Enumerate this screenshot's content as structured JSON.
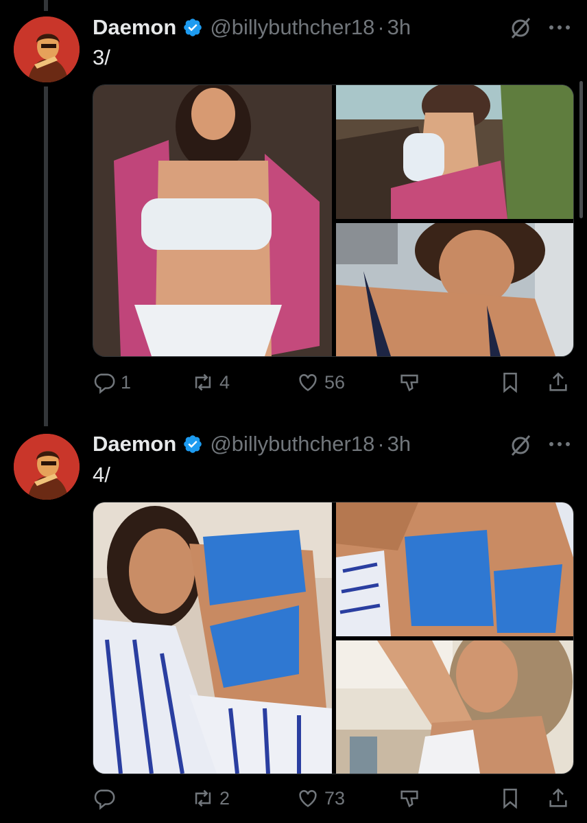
{
  "tweets": [
    {
      "author": "Daemon",
      "handle": "@billybuthcher18",
      "separator": "·",
      "time": "3h",
      "text": "3/",
      "stats": {
        "replies": "1",
        "retweets": "4",
        "likes": "56"
      }
    },
    {
      "author": "Daemon",
      "handle": "@billybuthcher18",
      "separator": "·",
      "time": "3h",
      "text": "4/",
      "stats": {
        "replies": "",
        "retweets": "2",
        "likes": "73"
      }
    }
  ],
  "colors": {
    "background": "#000000",
    "text": "#e7e9ea",
    "muted": "#71767b",
    "verified": "#1d9bf0",
    "thread_line": "#333639"
  },
  "icons": [
    "verified-badge-icon",
    "grok-icon",
    "more-icon",
    "reply-icon",
    "retweet-icon",
    "like-icon",
    "downvote-icon",
    "bookmark-icon",
    "share-icon"
  ]
}
